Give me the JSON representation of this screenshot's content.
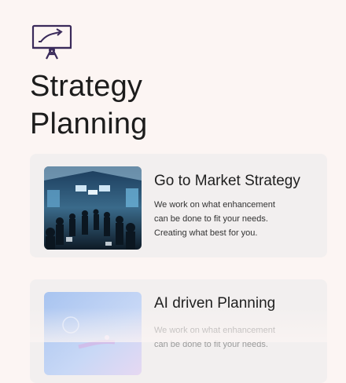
{
  "header": {
    "icon": "presentation-board-icon",
    "title_line1": "Strategy",
    "title_line2": "Planning"
  },
  "cards": [
    {
      "title": "Go to Market Strategy",
      "description_lines": [
        "We work on what enhancement",
        "can be done to fit your needs.",
        "Creating what best for you."
      ],
      "image": "conference-crowd-image"
    },
    {
      "title": "AI driven Planning",
      "description_lines": [
        "We work on what enhancement",
        "can be done to fit your needs."
      ],
      "image": "ai-robot-hand-image"
    }
  ],
  "colors": {
    "background": "#fcf5f3",
    "card": "#f2efef",
    "icon_stroke": "#3a2a5a"
  }
}
